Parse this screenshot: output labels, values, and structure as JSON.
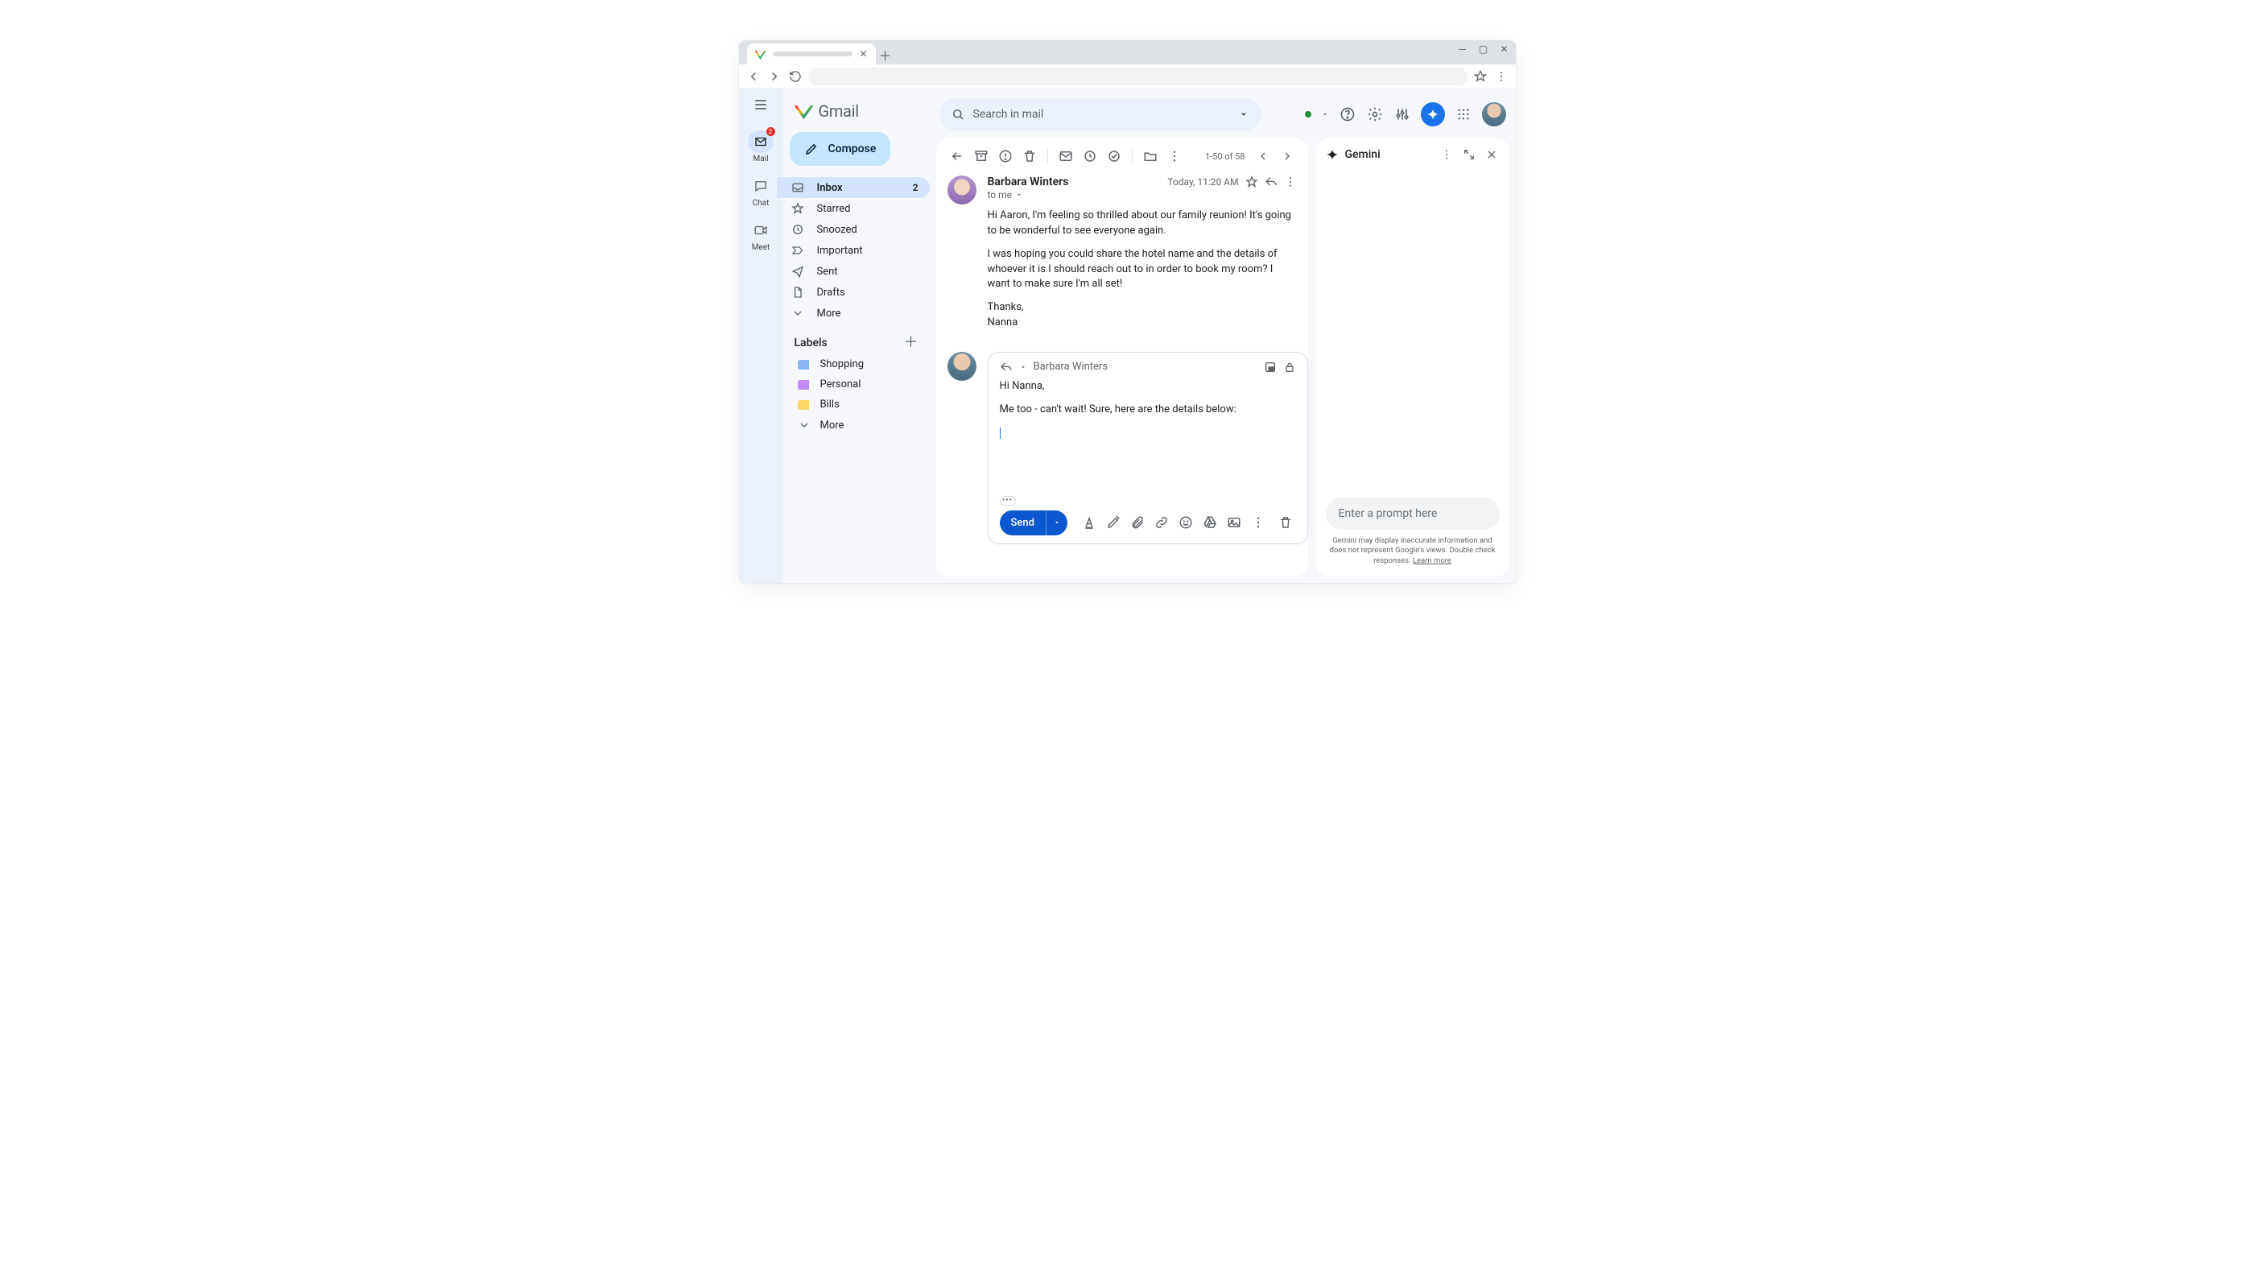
{
  "app": {
    "name": "Gmail"
  },
  "rail": {
    "items": [
      {
        "label": "Mail",
        "badge": "2"
      },
      {
        "label": "Chat"
      },
      {
        "label": "Meet"
      }
    ]
  },
  "sidebar": {
    "compose": "Compose",
    "folders": [
      {
        "label": "Inbox",
        "count": "2",
        "active": true
      },
      {
        "label": "Starred"
      },
      {
        "label": "Snoozed"
      },
      {
        "label": "Important"
      },
      {
        "label": "Sent"
      },
      {
        "label": "Drafts"
      },
      {
        "label": "More"
      }
    ],
    "labels_heading": "Labels",
    "labels": [
      {
        "label": "Shopping",
        "color": "#8ab4f8"
      },
      {
        "label": "Personal",
        "color": "#c58af9"
      },
      {
        "label": "Bills",
        "color": "#fdd663"
      }
    ],
    "labels_more": "More"
  },
  "search": {
    "placeholder": "Search in mail"
  },
  "toolbar": {
    "page_counter": "1-50 of 58"
  },
  "message": {
    "sender": "Barbara Winters",
    "to_line": "to me",
    "timestamp": "Today, 11:20 AM",
    "body": {
      "p1": "Hi Aaron,  I'm feeling so thrilled about our family reunion! It's going to be wonderful to see everyone again.",
      "p2": "I was hoping you could share the hotel name and the details of whoever it is I should reach out to in order to book my room? I want to make sure I'm all set!",
      "p3": "Thanks,",
      "p4": "Nanna"
    }
  },
  "reply": {
    "recipient": "Barbara Winters",
    "body": {
      "l1": "Hi Nanna,",
      "l2": "Me too - can't wait! Sure, here are the details below:"
    },
    "send_label": "Send"
  },
  "gemini": {
    "title": "Gemini",
    "prompt_placeholder": "Enter a prompt here",
    "disclaimer_a": "Gemini may display inaccurate information and does not represent Google's views. Double check responses. ",
    "learn_more": "Learn more"
  }
}
